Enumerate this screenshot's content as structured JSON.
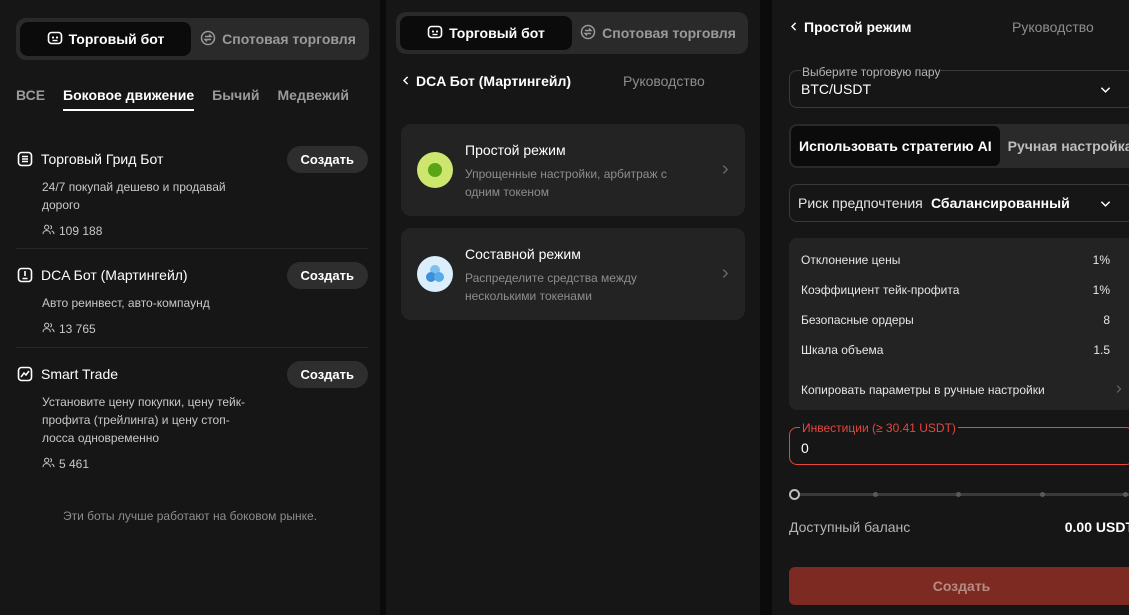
{
  "colors": {
    "accent_red": "#e8453c",
    "submit_bg": "#7d2a22",
    "simple_mode": "#cde66e",
    "composite_mode": "#5aa9e8"
  },
  "panel1": {
    "tabs": [
      {
        "label": "Торговый бот",
        "icon": "bot-icon"
      },
      {
        "label": "Спотовая торговля",
        "icon": "swap-icon"
      }
    ],
    "filters": [
      "ВСЕ",
      "Боковое движение",
      "Бычий",
      "Медвежий"
    ],
    "active_filter": "Боковое движение",
    "bots": [
      {
        "name": "Торговый Грид Бот",
        "icon": "grid-bot-icon",
        "desc": "24/7 покупай дешево и продавай дорого",
        "users": "109 188",
        "action": "Создать"
      },
      {
        "name": "DCA Бот (Мартингейл)",
        "icon": "dca-bot-icon",
        "desc": "Авто реинвест, авто-компаунд",
        "users": "13 765",
        "action": "Создать"
      },
      {
        "name": "Smart Trade",
        "icon": "smart-trade-icon",
        "desc": "Установите цену покупки, цену тейк-профита (трейлинга) и цену стоп-лосса одновременно",
        "users": "5 461",
        "action": "Создать"
      }
    ],
    "footnote": "Эти боты лучше работают на боковом рынке."
  },
  "panel2": {
    "tabs": [
      {
        "label": "Торговый бот",
        "icon": "bot-icon"
      },
      {
        "label": "Спотовая торговля",
        "icon": "swap-icon"
      }
    ],
    "back_label": "DCA Бот (Мартингейл)",
    "guide": "Руководство",
    "modes": [
      {
        "title": "Простой режим",
        "sub": "Упрощенные настройки, арбитраж с одним токеном",
        "icon": "simple-mode-icon"
      },
      {
        "title": "Составной режим",
        "sub": "Распределите средства между несколькими токенами",
        "icon": "composite-mode-icon"
      }
    ]
  },
  "panel3": {
    "back_label": "Простой режим",
    "guide": "Руководство",
    "pair": {
      "label": "Выберите торговую пару",
      "value": "BTC/USDT"
    },
    "strategy_tabs": [
      "Использовать стратегию AI",
      "Ручная настройка"
    ],
    "risk": {
      "label": "Риск предпочтения",
      "value": "Сбалансированный"
    },
    "params": [
      {
        "k": "Отклонение цены",
        "v": "1%"
      },
      {
        "k": "Коэффициент тейк-профита",
        "v": "1%"
      },
      {
        "k": "Безопасные ордеры",
        "v": "8"
      },
      {
        "k": "Шкала объема",
        "v": "1.5"
      }
    ],
    "copy_label": "Копировать параметры в ручные настройки",
    "investment": {
      "label": "Инвестиции (≥ 30.41 USDT)",
      "value": "0"
    },
    "slider_percent": 0,
    "balance": {
      "label": "Доступный баланс",
      "value": "0.00 USDT"
    },
    "submit": "Создать"
  }
}
